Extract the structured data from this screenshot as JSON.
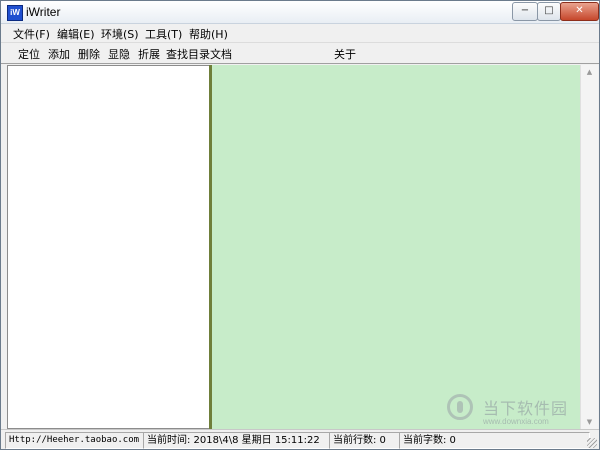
{
  "window": {
    "title": "iWriter",
    "icon_name": "iw-app-icon",
    "icon_text": "iW"
  },
  "window_controls": {
    "minimize": "−",
    "maximize": "□",
    "close": "✕"
  },
  "menu": {
    "items": [
      {
        "label": "文件(F)"
      },
      {
        "label": "编辑(E)"
      },
      {
        "label": "环境(S)"
      },
      {
        "label": "工具(T)"
      },
      {
        "label": "帮助(H)"
      }
    ]
  },
  "toolbar": {
    "locate": "定位",
    "add": "添加",
    "delete": "删除",
    "toggle": "显隐",
    "collapse": "折展",
    "find": "查找目录文档",
    "about": "关于"
  },
  "status": {
    "link": "Http://Heeher.taobao.com",
    "time": "当前时间: 2018\\4\\8  星期日  15:11:22",
    "line": "当前行数: 0",
    "chars": "当前字数: 0"
  },
  "colors": {
    "editor_bg": "#c7ecc9",
    "splitter": "#6f7f3a"
  },
  "watermark": {
    "name": "当下软件园",
    "url": "www.downxia.com"
  }
}
